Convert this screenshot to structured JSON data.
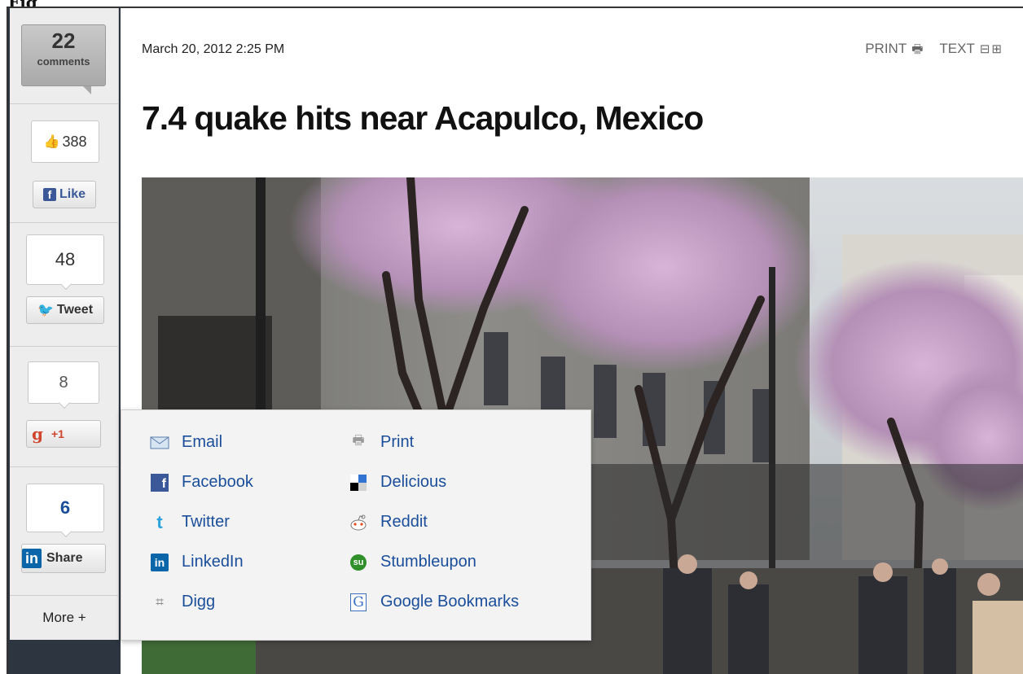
{
  "figure_label": "Fig",
  "sidebar": {
    "comments_count": "22",
    "comments_label": "comments",
    "fb_count": "388",
    "fb_like_label": "Like",
    "tweet_count": "48",
    "tweet_label": "Tweet",
    "gplus_count": "8",
    "gplus_label": "+1",
    "linkedin_count": "6",
    "linkedin_label": "Share",
    "more_label": "More +"
  },
  "article": {
    "dateline": "March 20, 2012 2:25 PM",
    "print_label": "PRINT",
    "text_label": "TEXT",
    "headline": "7.4 quake hits near Acapulco, Mexico"
  },
  "share_menu": {
    "left": [
      {
        "label": "Email",
        "icon": "email-icon"
      },
      {
        "label": "Facebook",
        "icon": "facebook-icon"
      },
      {
        "label": "Twitter",
        "icon": "twitter-icon"
      },
      {
        "label": "LinkedIn",
        "icon": "linkedin-icon"
      },
      {
        "label": "Digg",
        "icon": "digg-icon"
      }
    ],
    "right": [
      {
        "label": "Print",
        "icon": "print-icon"
      },
      {
        "label": "Delicious",
        "icon": "delicious-icon"
      },
      {
        "label": "Reddit",
        "icon": "reddit-icon"
      },
      {
        "label": "Stumbleupon",
        "icon": "stumbleupon-icon"
      },
      {
        "label": "Google Bookmarks",
        "icon": "google-bookmarks-icon"
      }
    ]
  },
  "colors": {
    "link": "#1a4e9b",
    "facebook": "#3b5998",
    "linkedin": "#0a66a8",
    "twitter": "#2aa3dd",
    "gplus": "#d0452d"
  }
}
